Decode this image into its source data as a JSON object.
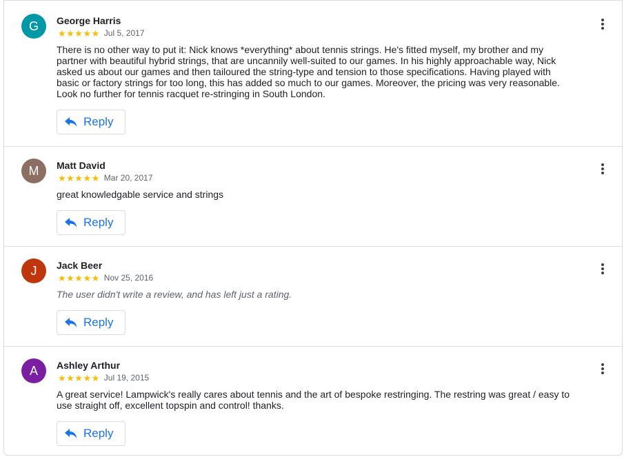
{
  "reviews": [
    {
      "initial": "G",
      "avatar_color": "#0097a7",
      "name": "George Harris",
      "stars": "★★★★★",
      "date": "Jul 5, 2017",
      "text": "There is no other way to put it: Nick knows *everything* about tennis strings. He's fitted myself, my brother and my partner with beautiful hybrid strings, that are uncannily well-suited to our games. In his highly approachable way, Nick asked us about our games and then tailoured the string-type and tension to those specifications. Having played with basic or factory strings for too long, this has added so much to our games. Moreover, the pricing was very reasonable. Look no further for tennis racquet re-stringing in South London.",
      "reply_label": "Reply"
    },
    {
      "initial": "M",
      "avatar_color": "#8d6e63",
      "name": "Matt David",
      "stars": "★★★★★",
      "date": "Mar 20, 2017",
      "text": "great knowledgable service and strings",
      "reply_label": "Reply"
    },
    {
      "initial": "J",
      "avatar_color": "#bf360c",
      "name": "Jack Beer",
      "stars": "★★★★★",
      "date": "Nov 25, 2016",
      "text": "The user didn't write a review, and has left just a rating.",
      "reply_label": "Reply"
    },
    {
      "initial": "A",
      "avatar_color": "#7b1fa2",
      "name": "Ashley Arthur",
      "stars": "★★★★★",
      "date": "Jul 19, 2015",
      "text": "A great service! Lampwick's really cares about tennis and the art of bespoke restringing. The restring was great / easy to use straight off, excellent topspin and control! thanks.",
      "reply_label": "Reply"
    }
  ],
  "icons": {
    "reply": "reply-arrow-icon",
    "more": "more-vert-icon",
    "star": "star-icon"
  },
  "colors": {
    "star": "#fbbc04",
    "link": "#1a73e8",
    "border": "#dadce0"
  }
}
